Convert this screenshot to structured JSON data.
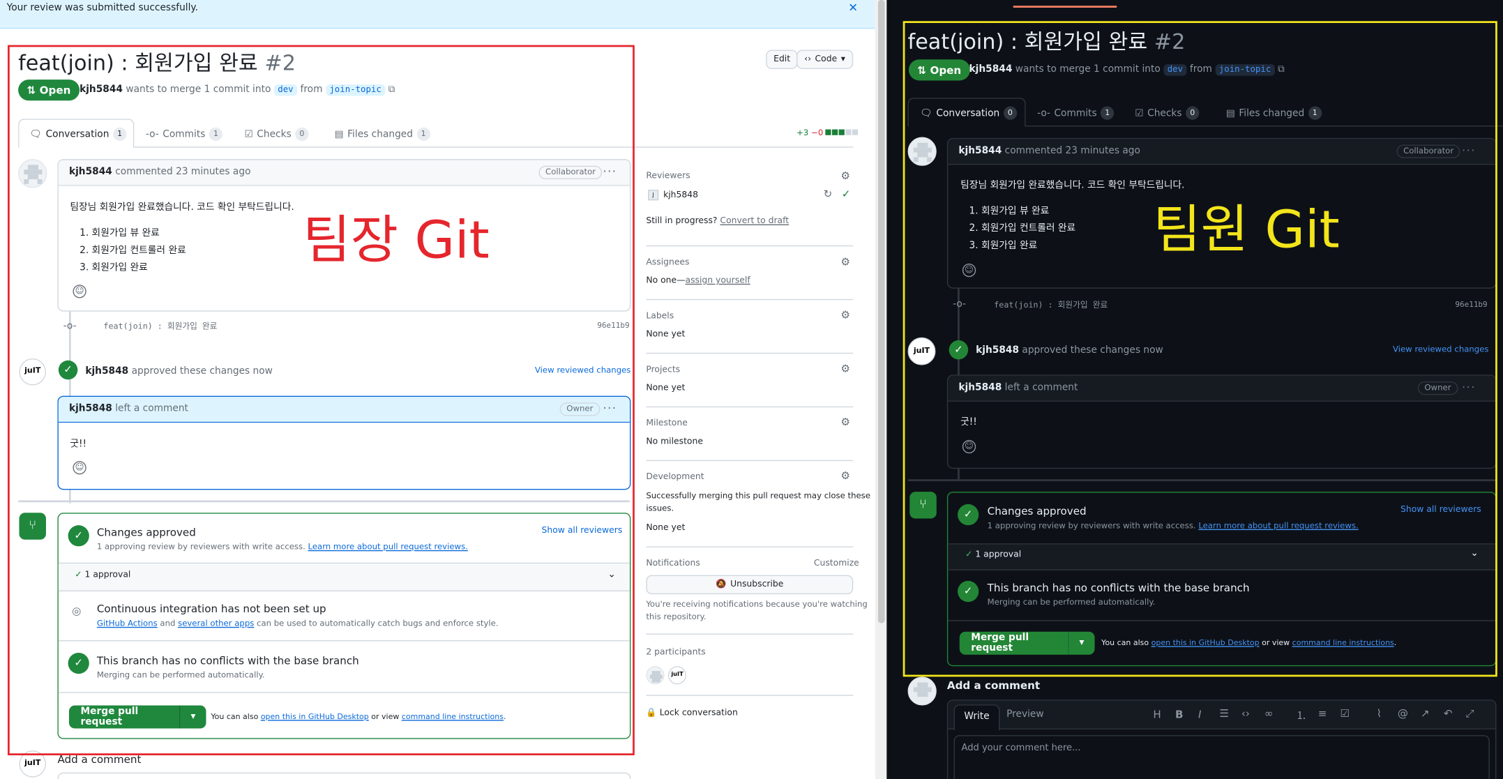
{
  "left": {
    "flash": "Your review was submitted successfully.",
    "title": "feat(join) : 회원가입 완료",
    "number": "#2",
    "status": "Open",
    "author": "kjh5844",
    "merge_text": "wants to merge 1 commit into",
    "base": "dev",
    "from": "from",
    "head": "join-topic",
    "edit": "Edit",
    "code": "Code",
    "tabs": [
      {
        "label": "Conversation",
        "count": "1"
      },
      {
        "label": "Commits",
        "count": "1"
      },
      {
        "label": "Checks",
        "count": "0"
      },
      {
        "label": "Files changed",
        "count": "1"
      }
    ],
    "diffstat_add": "+3",
    "diffstat_del": "−0",
    "comment1": {
      "author": "kjh5844",
      "action": "commented 23 minutes ago",
      "role": "Collaborator",
      "body": "팀장님 회원가입 완료했습니다. 코드 확인 부탁드립니다.",
      "items": [
        "1. 회원가입 뷰 완료",
        "2. 회원가입 컨트롤러 완료",
        "3. 회원가입 완료"
      ]
    },
    "commit": {
      "message": "feat(join) : 회원가입 완료",
      "sha": "96e11b9"
    },
    "review": {
      "author": "kjh5848",
      "action": "approved these changes now",
      "link": "View reviewed changes"
    },
    "comment2": {
      "author": "kjh5848",
      "action": "left a comment",
      "role": "Owner",
      "body": "굿!!"
    },
    "merge": {
      "approved_title": "Changes approved",
      "approved_sub": "1 approving review by reviewers with write access.",
      "learn": "Learn more about pull request reviews.",
      "show_all": "Show all reviewers",
      "approval": "1 approval",
      "ci_title": "Continuous integration has not been set up",
      "ci_link1": "GitHub Actions",
      "ci_and": "and",
      "ci_link2": "several other apps",
      "ci_rest": "can be used to automatically catch bugs and enforce style.",
      "conflict_title": "This branch has no conflicts with the base branch",
      "conflict_sub": "Merging can be performed automatically.",
      "button": "Merge pull request",
      "also": "You can also",
      "open_desktop": "open this in GitHub Desktop",
      "or_view": "or view",
      "cli": "command line instructions",
      "period": "."
    },
    "add_comment": "Add a comment",
    "sidebar": {
      "reviewers": "Reviewers",
      "reviewer_name": "kjh5848",
      "in_progress": "Still in progress?",
      "convert": "Convert to draft",
      "assignees": "Assignees",
      "no_one": "No one—",
      "assign_yourself": "assign yourself",
      "labels": "Labels",
      "labels_val": "None yet",
      "projects": "Projects",
      "projects_val": "None yet",
      "milestone": "Milestone",
      "milestone_val": "No milestone",
      "development": "Development",
      "dev_text1": "Successfully merging this pull request may close these",
      "dev_text2": "issues.",
      "dev_val": "None yet",
      "notifications": "Notifications",
      "customize": "Customize",
      "unsubscribe": "Unsubscribe",
      "notif_text1": "You're receiving notifications because you're watching",
      "notif_text2": "this repository.",
      "participants": "2 participants",
      "lock": "Lock conversation"
    },
    "annotation": "팀장 Git"
  },
  "right": {
    "title": "feat(join) : 회원가입 완료",
    "number": "#2",
    "status": "Open",
    "author": "kjh5844",
    "merge_text": "wants to merge 1 commit into",
    "base": "dev",
    "from": "from",
    "head": "join-topic",
    "tabs": [
      {
        "label": "Conversation",
        "count": "0"
      },
      {
        "label": "Commits",
        "count": "1"
      },
      {
        "label": "Checks",
        "count": "0"
      },
      {
        "label": "Files changed",
        "count": "1"
      }
    ],
    "comment1": {
      "author": "kjh5844",
      "action": "commented 23 minutes ago",
      "role": "Collaborator",
      "body": "팀장님 회원가입 완료했습니다. 코드 확인 부탁드립니다.",
      "items": [
        "1. 회원가입 뷰 완료",
        "2. 회원가입 컨트롤러 완료",
        "3. 회원가입 완료"
      ]
    },
    "commit": {
      "message": "feat(join) : 회원가입 완료",
      "sha": "96e11b9"
    },
    "review": {
      "author": "kjh5848",
      "action": "approved these changes now",
      "link": "View reviewed changes"
    },
    "comment2": {
      "author": "kjh5848",
      "action": "left a comment",
      "role": "Owner",
      "body": "굿!!"
    },
    "merge": {
      "approved_title": "Changes approved",
      "approved_sub": "1 approving review by reviewers with write access.",
      "learn": "Learn more about pull request reviews.",
      "show_all": "Show all reviewers",
      "approval": "1 approval",
      "conflict_title": "This branch has no conflicts with the base branch",
      "conflict_sub": "Merging can be performed automatically.",
      "button": "Merge pull request",
      "also": "You can also",
      "open_desktop": "open this in GitHub Desktop",
      "or_view": "or view",
      "cli": "command line instructions",
      "period": "."
    },
    "add_comment": "Add a comment",
    "write": "Write",
    "preview": "Preview",
    "placeholder": "Add your comment here...",
    "annotation": "팀원 Git"
  },
  "colors": {
    "red": "#e5262d",
    "yellow": "#f3e51b",
    "green": "#1f883d",
    "blue": "#0969da"
  }
}
